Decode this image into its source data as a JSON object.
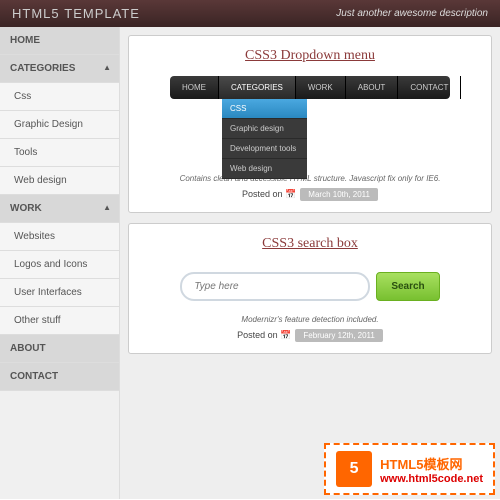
{
  "header": {
    "logo_main": "HTML5",
    "logo_sub": "Template",
    "tagline": "Just another awesome description"
  },
  "sidebar": {
    "items": [
      {
        "label": "HOME",
        "type": "header"
      },
      {
        "label": "CATEGORIES",
        "type": "header",
        "arrow": "▲"
      },
      {
        "label": "Css",
        "type": "sub"
      },
      {
        "label": "Graphic Design",
        "type": "sub"
      },
      {
        "label": "Tools",
        "type": "sub"
      },
      {
        "label": "Web design",
        "type": "sub"
      },
      {
        "label": "WORK",
        "type": "header",
        "arrow": "▲"
      },
      {
        "label": "Websites",
        "type": "sub"
      },
      {
        "label": "Logos and Icons",
        "type": "sub"
      },
      {
        "label": "User Interfaces",
        "type": "sub"
      },
      {
        "label": "Other stuff",
        "type": "sub"
      },
      {
        "label": "ABOUT",
        "type": "header"
      },
      {
        "label": "CONTACT",
        "type": "header"
      }
    ]
  },
  "card1": {
    "title": "CSS3 Dropdown menu",
    "nav": [
      "HOME",
      "CATEGORIES",
      "WORK",
      "ABOUT",
      "CONTACT"
    ],
    "submenu": [
      "CSS",
      "Graphic design",
      "Development tools",
      "Web design"
    ],
    "desc": "Contains clean and accessible HTML structure. Javascript fix only for IE6.",
    "posted": "Posted on",
    "date": "March 10th, 2011"
  },
  "card2": {
    "title": "CSS3 search box",
    "placeholder": "Type here",
    "button": "Search",
    "desc": "Modernizr's feature detection included.",
    "posted": "Posted on",
    "date": "February 12th, 2011"
  },
  "watermark": {
    "badge": "5",
    "text_cn": "HTML5模板网",
    "url": "www.html5code.net"
  }
}
